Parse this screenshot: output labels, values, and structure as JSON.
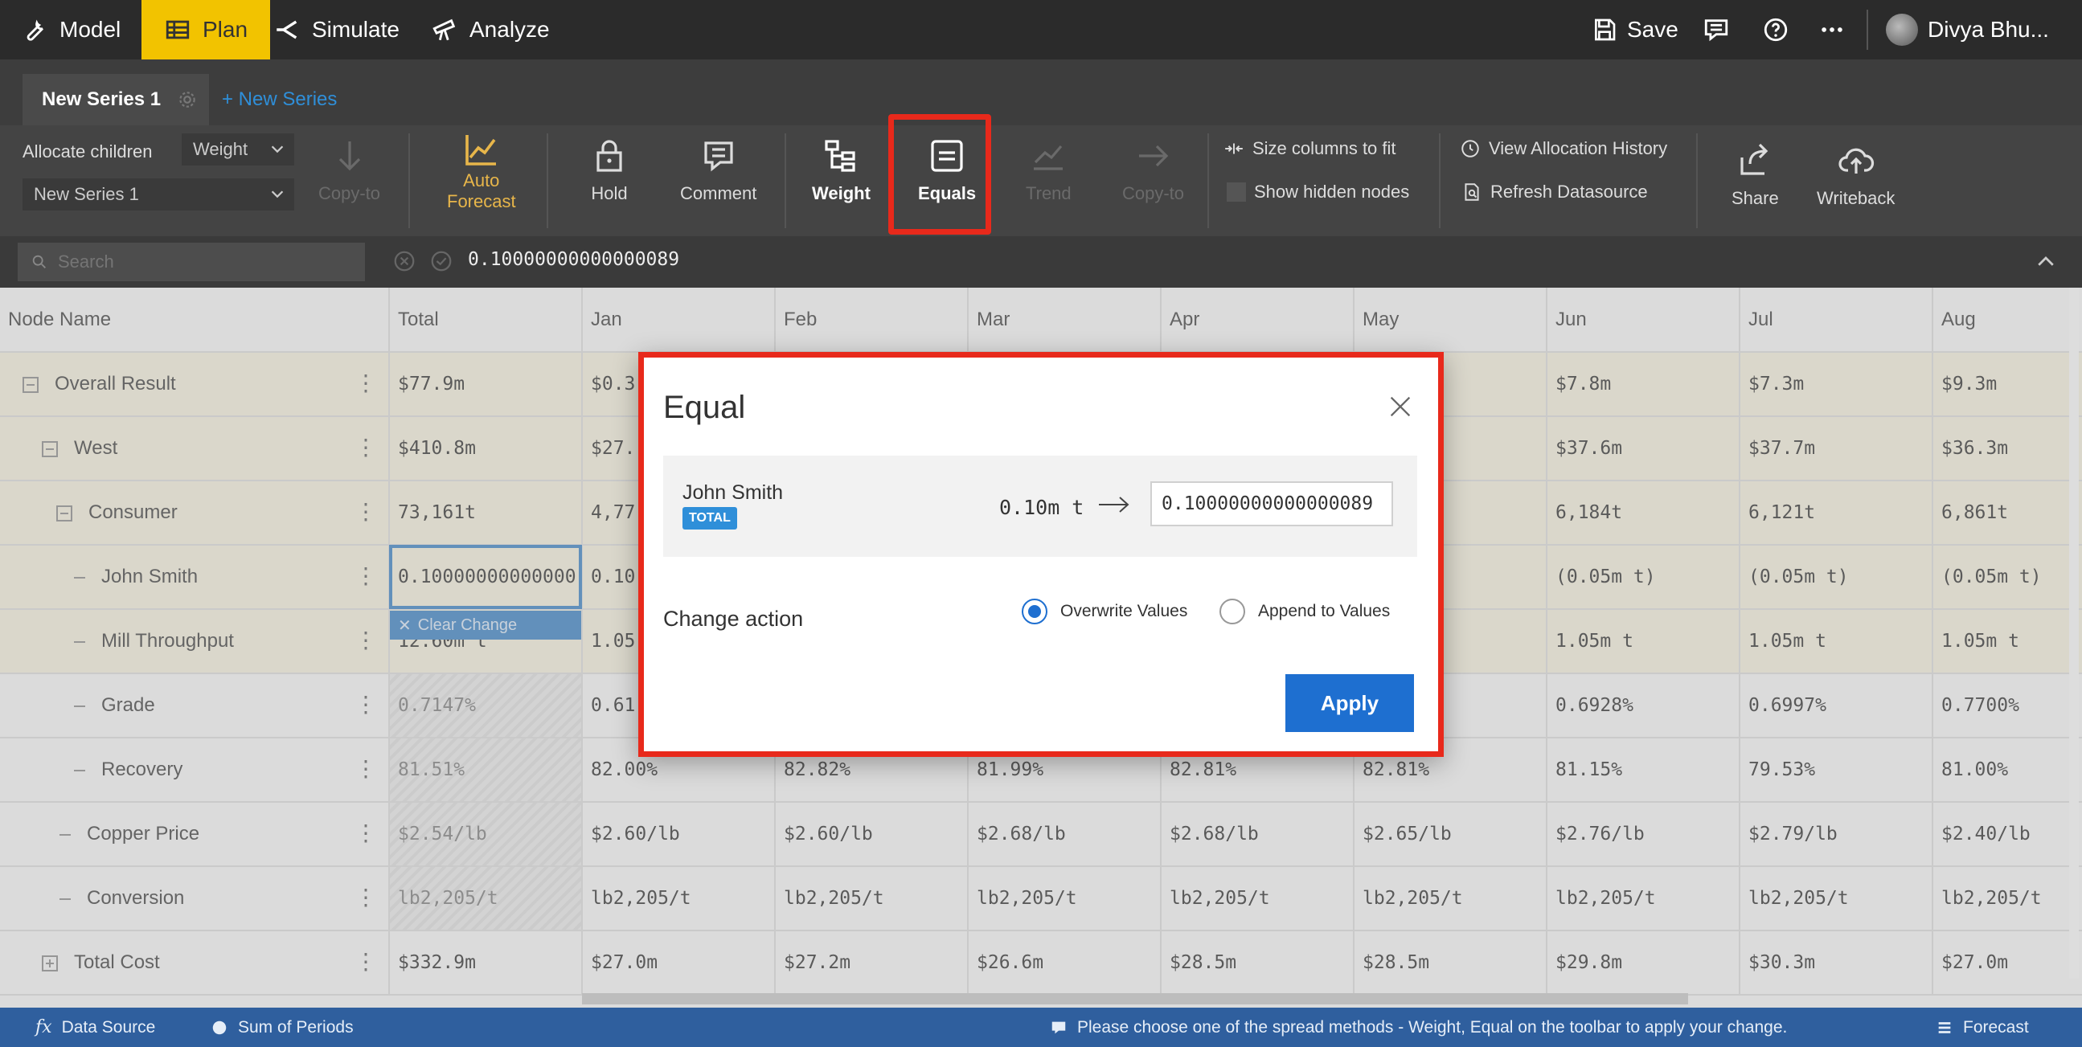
{
  "nav": {
    "model": "Model",
    "plan": "Plan",
    "simulate": "Simulate",
    "analyze": "Analyze",
    "save": "Save",
    "user": "Divya Bhu..."
  },
  "tabs": {
    "active": "New Series 1",
    "new": "+ New Series"
  },
  "toolbar": {
    "allocate_label": "Allocate children",
    "allocate_value": "Weight",
    "series_value": "New Series 1",
    "copy_to_1": "Copy-to",
    "auto_forecast_1": "Auto",
    "auto_forecast_2": "Forecast",
    "hold": "Hold",
    "comment": "Comment",
    "weight": "Weight",
    "equals": "Equals",
    "trend": "Trend",
    "copy_to_2": "Copy-to",
    "size_columns": "Size columns to fit",
    "show_hidden": "Show hidden nodes",
    "view_history": "View Allocation History",
    "refresh_ds": "Refresh Datasource",
    "share": "Share",
    "writeback": "Writeback"
  },
  "formula": {
    "search_placeholder": "Search",
    "value": "0.10000000000000089"
  },
  "grid": {
    "headers": [
      "Node Name",
      "Total",
      "Jan",
      "Feb",
      "Mar",
      "Apr",
      "May",
      "Jun",
      "Jul",
      "Aug"
    ],
    "rows": [
      {
        "name": "Overall Result",
        "cells": [
          "$77.9m",
          "$0.3",
          "",
          "",
          "",
          "",
          "$7.8m",
          "$7.3m",
          "$9.3m"
        ]
      },
      {
        "name": "West",
        "cells": [
          "$410.8m",
          "$27.",
          "",
          "",
          "",
          "",
          "$37.6m",
          "$37.7m",
          "$36.3m"
        ]
      },
      {
        "name": "Consumer",
        "cells": [
          "73,161t",
          "4,77",
          "",
          "",
          "",
          "",
          "6,184t",
          "6,121t",
          "6,861t"
        ]
      },
      {
        "name": "John Smith",
        "cells": [
          "0.10000000000000",
          "0.10",
          "",
          "",
          "",
          "",
          "(0.05m t)",
          "(0.05m t)",
          "(0.05m t)"
        ]
      },
      {
        "name": "Mill Throughput",
        "cells": [
          "12.60m t",
          "1.05",
          "",
          "",
          "",
          "",
          "1.05m t",
          "1.05m t",
          "1.05m t"
        ]
      },
      {
        "name": "Grade",
        "cells": [
          "0.7147%",
          "0.61",
          "",
          "",
          "",
          "",
          "0.6928%",
          "0.6997%",
          "0.7700%"
        ]
      },
      {
        "name": "Recovery",
        "cells": [
          "81.51%",
          "82.00%",
          "82.82%",
          "81.99%",
          "82.81%",
          "82.81%",
          "81.15%",
          "79.53%",
          "81.00%"
        ]
      },
      {
        "name": "Copper Price",
        "cells": [
          "$2.54/lb",
          "$2.60/lb",
          "$2.60/lb",
          "$2.68/lb",
          "$2.68/lb",
          "$2.65/lb",
          "$2.76/lb",
          "$2.79/lb",
          "$2.40/lb"
        ]
      },
      {
        "name": "Conversion",
        "cells": [
          "lb2,205/t",
          "lb2,205/t",
          "lb2,205/t",
          "lb2,205/t",
          "lb2,205/t",
          "lb2,205/t",
          "lb2,205/t",
          "lb2,205/t",
          "lb2,205/t"
        ]
      },
      {
        "name": "Total Cost",
        "cells": [
          "$332.9m",
          "$27.0m",
          "$27.2m",
          "$26.6m",
          "$28.5m",
          "$28.5m",
          "$29.8m",
          "$30.3m",
          "$27.0m"
        ]
      }
    ],
    "clear_change": "Clear Change"
  },
  "dialog": {
    "title": "Equal",
    "node_name": "John Smith",
    "badge": "TOTAL",
    "old_value": "0.10m t",
    "new_value": "0.10000000000000089",
    "change_action_label": "Change action",
    "option_overwrite": "Overwrite Values",
    "option_append": "Append to Values",
    "apply": "Apply"
  },
  "status": {
    "data_source": "Data Source",
    "sum_of_periods": "Sum of Periods",
    "message": "Please choose one of the spread methods - Weight, Equal on the toolbar to apply your change.",
    "forecast": "Forecast"
  },
  "colors": {
    "accent_yellow": "#f2c300",
    "primary_blue": "#1e6fd0",
    "highlight_red": "#e8291b",
    "statusbar": "#2f5f9e"
  }
}
